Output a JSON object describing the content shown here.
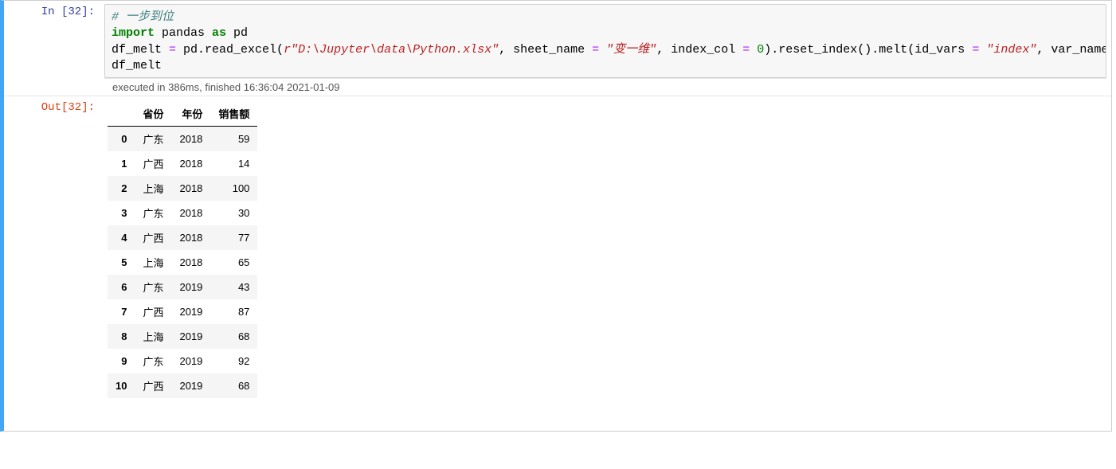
{
  "cell": {
    "in_prompt": "In [32]:",
    "out_prompt": "Out[32]:",
    "exec_status": "executed in 386ms, finished 16:36:04 2021-01-09",
    "code": {
      "line1_comment": "# 一步到位",
      "line2_kw1": "import",
      "line2_mod": " pandas ",
      "line2_kw2": "as",
      "line2_alias": " pd",
      "line3_a": "df_melt ",
      "line3_eq": "=",
      "line3_b": " pd.read_excel(",
      "line3_str1": "r\"D:\\Jupyter\\data\\Python.xlsx\"",
      "line3_c": ", sheet_name ",
      "line3_eq2": "=",
      "line3_d": " ",
      "line3_str2": "\"变一维\"",
      "line3_e": ", index_col ",
      "line3_eq3": "=",
      "line3_f": " ",
      "line3_num0": "0",
      "line3_g": ").reset_index().melt(id_vars ",
      "line3_eq4": "=",
      "line3_h": " ",
      "line3_str3": "\"index\"",
      "line3_i": ", var_name    ",
      "line4": "df_melt"
    }
  },
  "chart_data": {
    "type": "table",
    "columns": [
      "省份",
      "年份",
      "销售额"
    ],
    "index": [
      "0",
      "1",
      "2",
      "3",
      "4",
      "5",
      "6",
      "7",
      "8",
      "9",
      "10"
    ],
    "rows": [
      [
        "广东",
        "2018",
        "59"
      ],
      [
        "广西",
        "2018",
        "14"
      ],
      [
        "上海",
        "2018",
        "100"
      ],
      [
        "广东",
        "2018",
        "30"
      ],
      [
        "广西",
        "2018",
        "77"
      ],
      [
        "上海",
        "2018",
        "65"
      ],
      [
        "广东",
        "2019",
        "43"
      ],
      [
        "广西",
        "2019",
        "87"
      ],
      [
        "上海",
        "2019",
        "68"
      ],
      [
        "广东",
        "2019",
        "92"
      ],
      [
        "广西",
        "2019",
        "68"
      ]
    ]
  }
}
